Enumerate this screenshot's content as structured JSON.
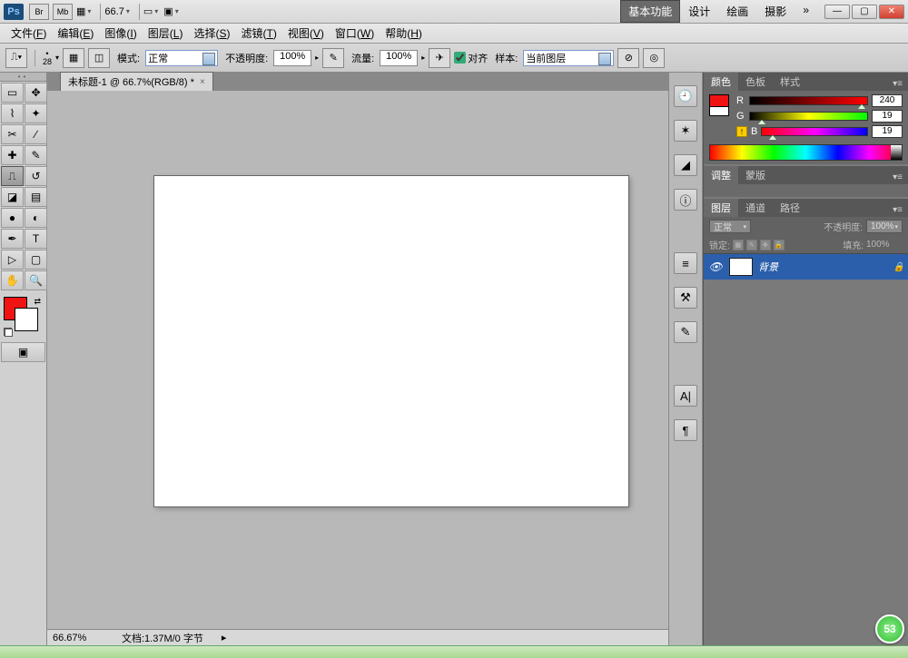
{
  "title_bar": {
    "br_label": "Br",
    "mb_label": "Mb",
    "zoom": "66.7",
    "workspaces": [
      "基本功能",
      "设计",
      "绘画",
      "摄影"
    ],
    "active_ws": 0,
    "more": "»"
  },
  "menu": {
    "items": [
      {
        "label": "文件",
        "key": "F"
      },
      {
        "label": "编辑",
        "key": "E"
      },
      {
        "label": "图像",
        "key": "I"
      },
      {
        "label": "图层",
        "key": "L"
      },
      {
        "label": "选择",
        "key": "S"
      },
      {
        "label": "滤镜",
        "key": "T"
      },
      {
        "label": "视图",
        "key": "V"
      },
      {
        "label": "窗口",
        "key": "W"
      },
      {
        "label": "帮助",
        "key": "H"
      }
    ]
  },
  "options": {
    "brush_size": "28",
    "mode_label": "模式:",
    "mode_value": "正常",
    "opacity_label": "不透明度:",
    "opacity_value": "100%",
    "flow_label": "流量:",
    "flow_value": "100%",
    "align_label": "对齐",
    "sample_label": "样本:",
    "sample_value": "当前图层"
  },
  "document": {
    "tab_title": "未标题-1 @ 66.7%(RGB/8) *"
  },
  "status": {
    "zoom": "66.67%",
    "doc_info": "文档:1.37M/0 字节"
  },
  "color_panel": {
    "tabs": [
      "颜色",
      "色板",
      "样式"
    ],
    "R": "240",
    "G": "19",
    "B": "19",
    "fg_hex": "#f01313"
  },
  "adjust_panel": {
    "tabs": [
      "调整",
      "蒙版"
    ]
  },
  "layers_panel": {
    "tabs": [
      "图层",
      "通道",
      "路径"
    ],
    "blend_mode": "正常",
    "opacity_label": "不透明度:",
    "opacity_value": "100%",
    "lock_label": "锁定:",
    "fill_label": "填充:",
    "fill_value": "100%",
    "layer_name": "背景"
  },
  "badge": "53"
}
